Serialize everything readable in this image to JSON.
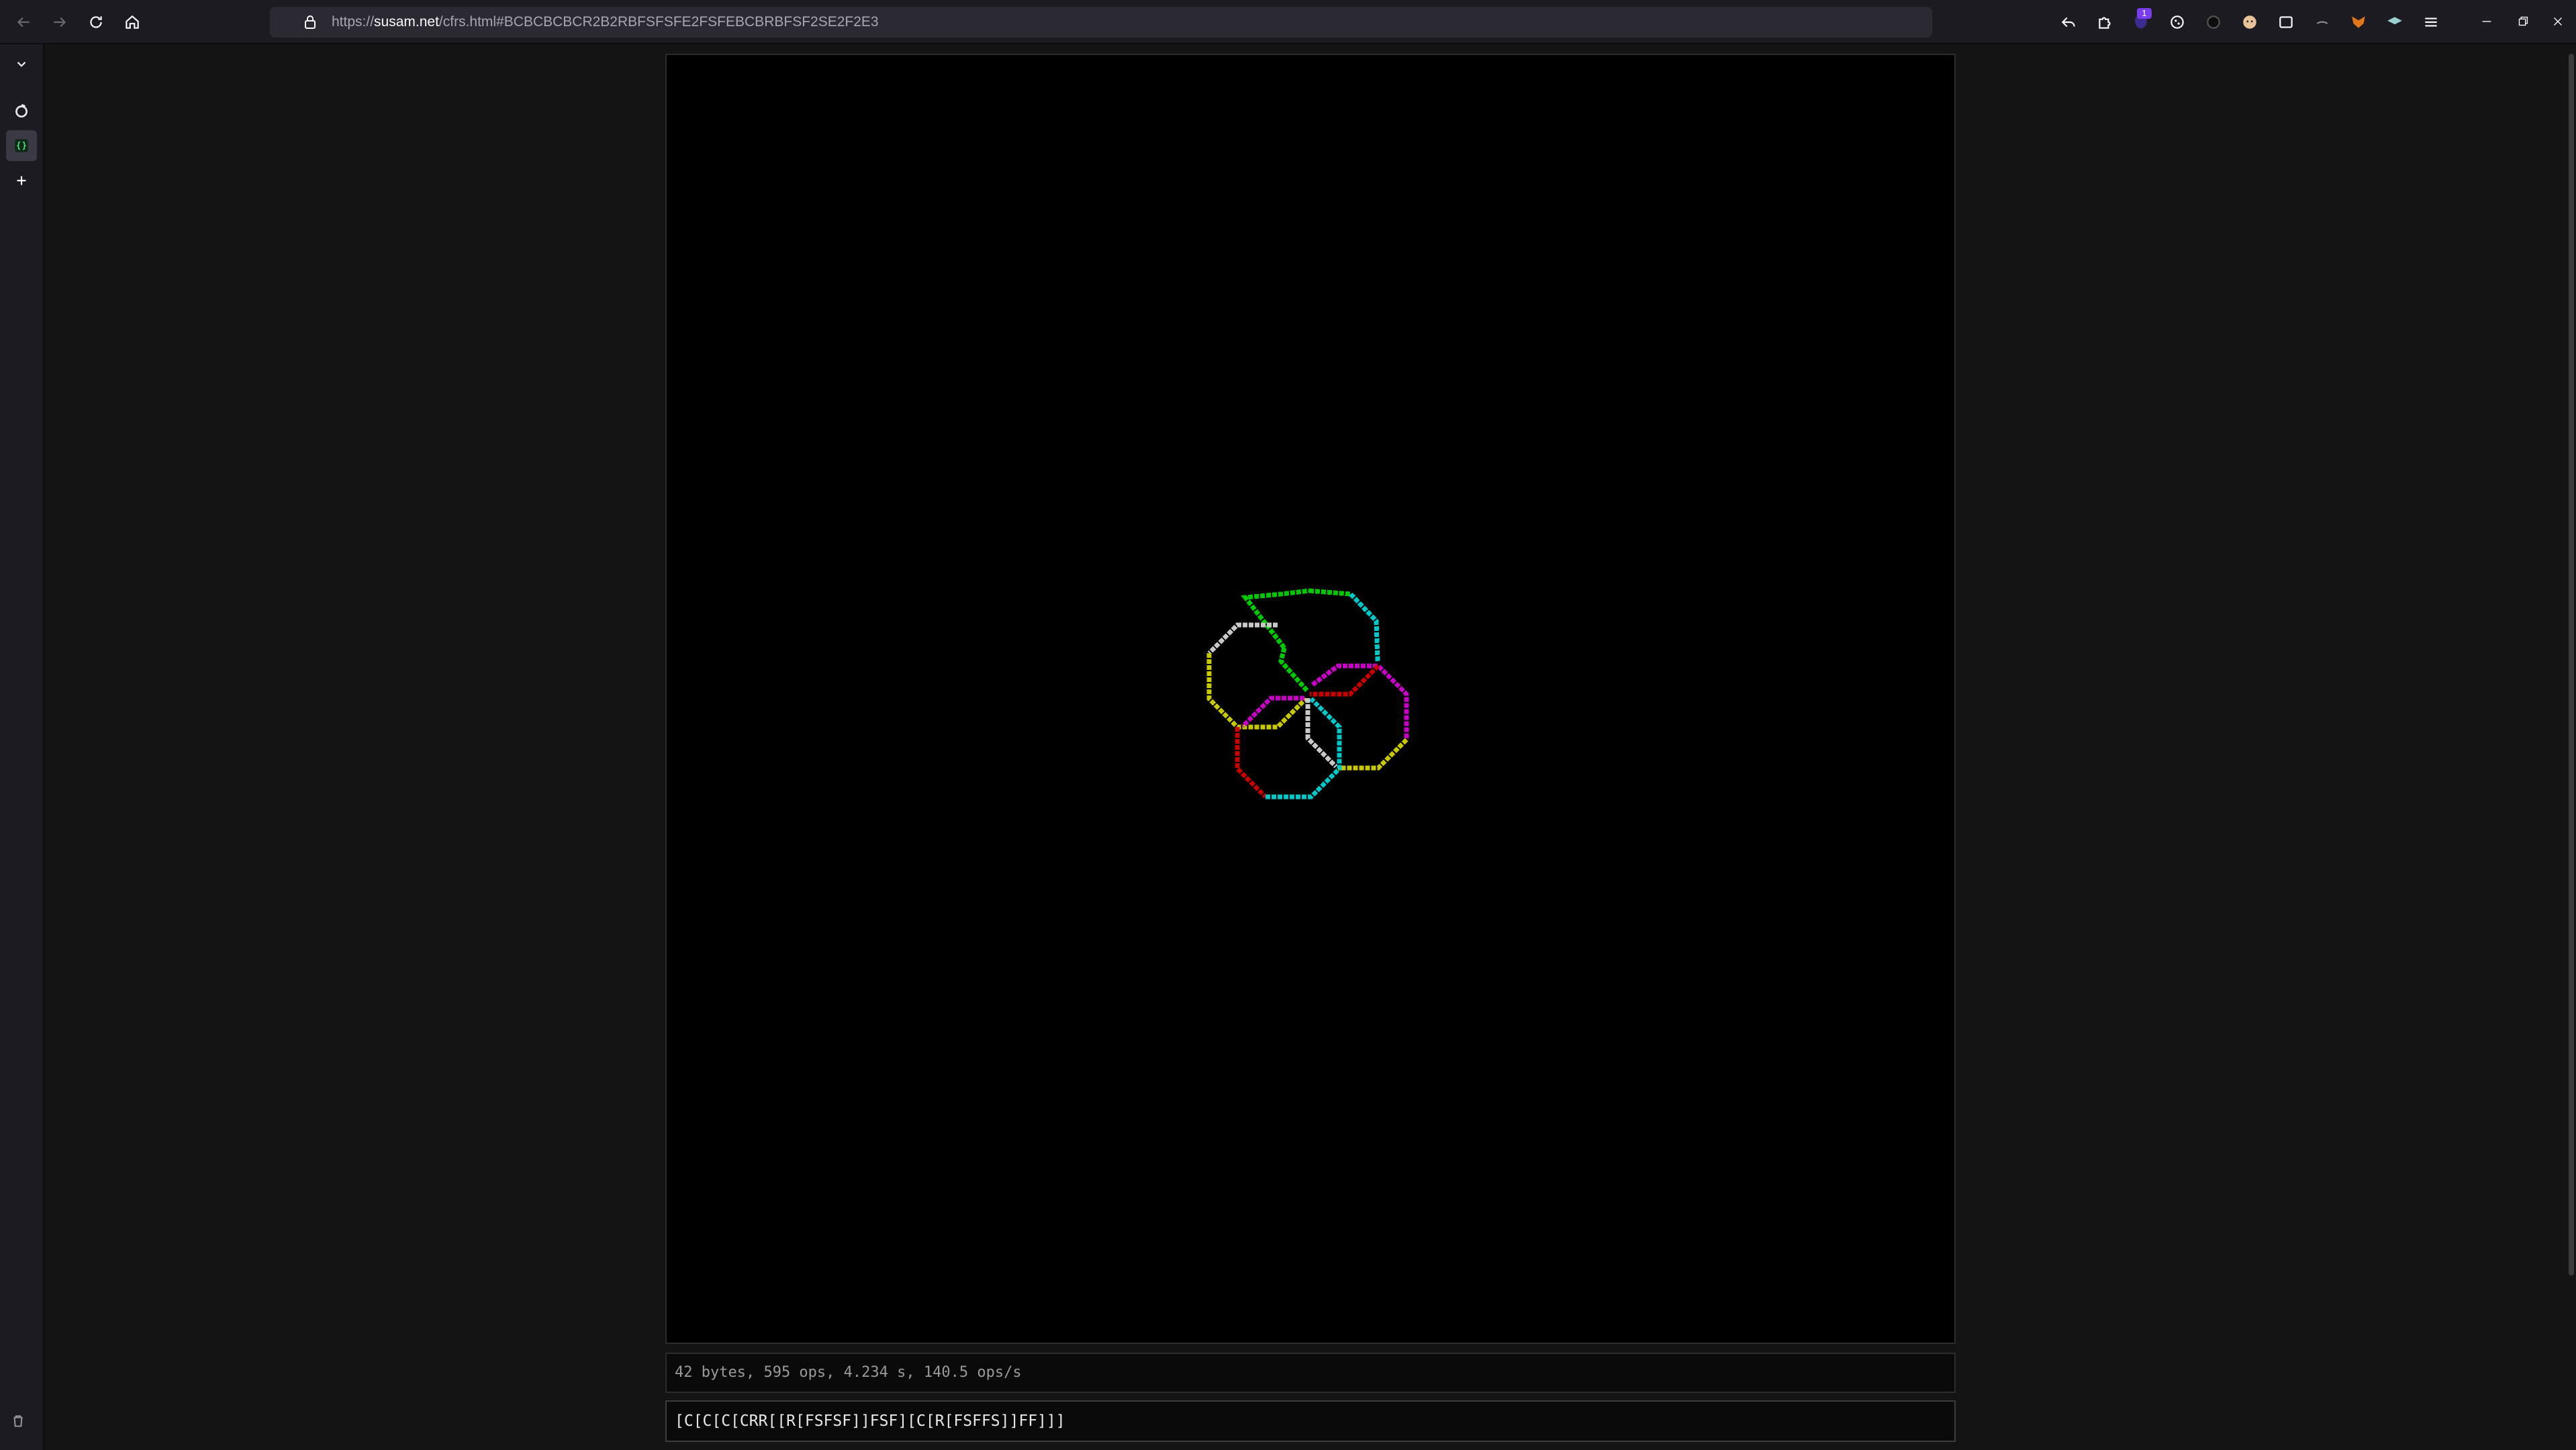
{
  "browser": {
    "url_host": "susam.net",
    "url_prefix": "https://",
    "url_path": "/cfrs.html#BCBCBCBCR2B2RBFSFSFE2FSFEBCBRBFSF2SE2F2E3",
    "extension_badge": "1",
    "icons": {
      "back": "back-arrow-icon",
      "forward": "forward-arrow-icon",
      "reload": "reload-icon",
      "home": "home-icon",
      "lock": "lock-icon",
      "undo": "undo-arrow-icon",
      "extensions": "puzzle-piece-icon",
      "menu": "hamburger-menu-icon"
    }
  },
  "sidebar": {
    "items": [
      {
        "name": "collapse",
        "icon": "chevron-down-icon"
      },
      {
        "name": "tab-1",
        "icon": "firefox-tab-icon"
      },
      {
        "name": "tab-2",
        "icon": "braces-tab-icon",
        "active": true
      },
      {
        "name": "new-tab",
        "icon": "plus-icon"
      },
      {
        "name": "trash",
        "icon": "trash-icon"
      }
    ]
  },
  "page": {
    "status_text": "42 bytes, 595 ops, 4.234 s, 140.5 ops/s",
    "code_value": "[C[C[C[CRR[[R[FSFSF]]FSF][C[R[FSFFS]]FF]]]"
  },
  "drawing": {
    "background": "#000000",
    "colors": {
      "green": "#00c800",
      "cyan": "#00c8c8",
      "magenta": "#c800c8",
      "red": "#c80000",
      "yellow": "#c8c800",
      "white": "#c8c8c8"
    }
  }
}
